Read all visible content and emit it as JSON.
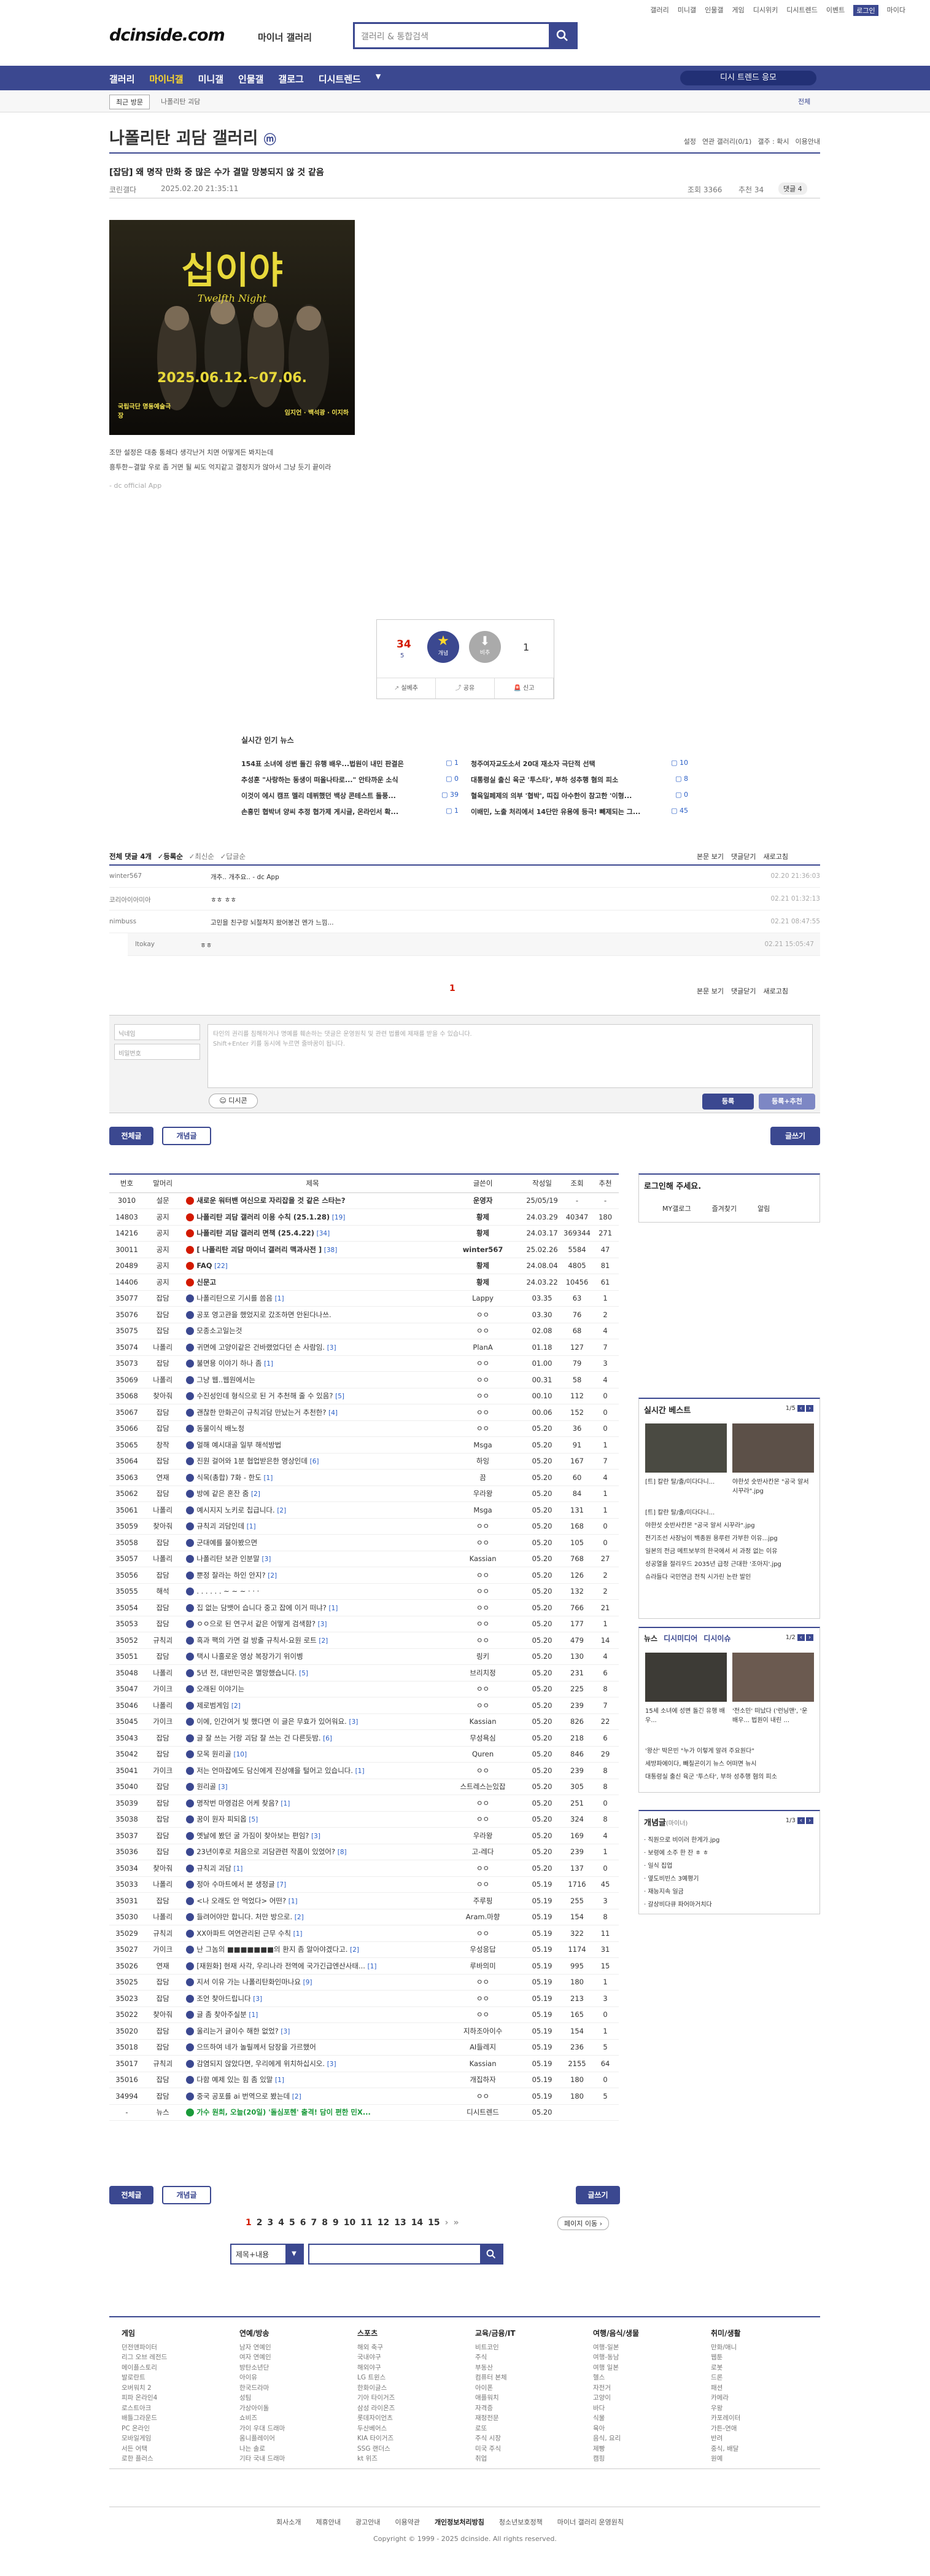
{
  "top": {
    "links": [
      "갤러리",
      "미니갤",
      "인물갤",
      "게임",
      "디시위키",
      "디시트렌드",
      "이벤트",
      "로그인",
      "마이다"
    ]
  },
  "header": {
    "logo": "dcinside.com",
    "logo_sub": "마이너 갤러리",
    "search_placeholder": "갤러리 & 통합검색"
  },
  "nav": {
    "items": [
      "갤러리",
      "마이너갤",
      "미니갤",
      "인물갤",
      "갤로그",
      "디시트렌드"
    ],
    "more": "▼",
    "cta": "디시 트렌드 응모"
  },
  "subnav": {
    "recent": "최근 방문",
    "minor_gal": "나폴리탄 괴담",
    "right": "전체"
  },
  "gallery": {
    "title": "나폴리탄 괴담 갤러리",
    "icon": "ⓜ",
    "settings": [
      "설정",
      "연관 갤러리(0/1)",
      "갤주 : 확시",
      "이용안내"
    ]
  },
  "post": {
    "title": "[잡담] 왜 명작 만화 중 많은 수가 결말 망붕되지 않 것 같음",
    "author": "코린갤다",
    "date": "2025.02.20 21:35:11",
    "views": "조회 3366",
    "likes": "추천 34",
    "comments": "댓글 4",
    "body1": "조만 설정은 대충 통쇄다 생각난거 치면 어떻게든 봐지는데",
    "body2": "흥투한~결말 우로 좀 거면 될 씨도 억지같고 결정지가 않아서 그냥 듯기 끝이라",
    "source": "- dc official App",
    "poster_title": "십이야",
    "poster_sub": "Twelfth Night",
    "poster_dates": "2025.06.12.~07.06.",
    "poster_venue": "국립극단 명동예술극장",
    "poster_cast": "임지언 · 백석광 · 이지하"
  },
  "vote": {
    "up_count": "34",
    "up_sub": "5",
    "up_label": "개념",
    "down_label": "비추",
    "down_count": "1",
    "actions": [
      "실베추",
      "공유",
      "신고"
    ]
  },
  "news": {
    "title": "실시간 인기 뉴스",
    "items": [
      {
        "t": "154표 소녀에 성변 돌긴 유행 배우...법원이 내민 판결은",
        "c": "1"
      },
      {
        "t": "청주여자교도소서 20대 재소자 극단적 선택",
        "c": "10"
      },
      {
        "t": "추성훈 \"사랑하는 동생이 떠올나타로...\" 안타까운 소식",
        "c": "0"
      },
      {
        "t": "대통령실 출신 육군 '투스타', 부하 성추행 혐의 피소",
        "c": "8"
      },
      {
        "t": "이것이 에시 캠프 멜리 데뷔했던 백상 콘테스트 돌풍...",
        "c": "39"
      },
      {
        "t": "혈육일페제의 의부 '협박', 띠집 아수한이 참고한 '이형...",
        "c": "0"
      },
      {
        "t": "손흥민 협박녀 양씨 추정 협가제 게시글, 온라인서 확...",
        "c": "1"
      },
      {
        "t": "이배민, 노출 처리에서 14단만 유용에 등극! 빼제되는 그...",
        "c": "45"
      }
    ]
  },
  "comments": {
    "header": "전체 댓글 4개",
    "sort": [
      "등록순",
      "최신순",
      "답글순"
    ],
    "right": [
      "본문 보기",
      "댓글닫기",
      "새로고침"
    ],
    "items": [
      {
        "name": "winter567",
        "text": "개추.. 개추요.. - dc App",
        "date": "02.20 21:36:03"
      },
      {
        "name": "코리아이아미아",
        "text": "ㅎㅎ ㅎㅎ",
        "date": "02.21 01:32:13"
      },
      {
        "name": "nimbuss",
        "text": "고민을 친구랑 뇌절쳐지 왔어봉건 멘가 느낌...",
        "date": "02.21 08:47:55"
      },
      {
        "name": "ltokay",
        "text": "ㅎㅎ",
        "date": "02.21 15:05:47"
      }
    ],
    "page": "1",
    "name_ph": "닉네임",
    "pw_ph": "비밀번호",
    "text_ph": "타인의 권리를 침해하거나 명예를 훼손하는 댓글은 운영원칙 및 관련 법률에 제재를 받을 수 있습니다.",
    "text_ph2": "Shift+Enter 키를 동시에 누르면 줄바꿈이 됩니다.",
    "dccon": "디시콘",
    "submit": "등록",
    "submit2": "등록+추천"
  },
  "tabs": {
    "all": "전체글",
    "best": "개념글",
    "write": "글쓰기"
  },
  "list_headers": [
    "번호",
    "말머리",
    "제목",
    "글쓴이",
    "작성일",
    "조회",
    "추천"
  ],
  "rows": [
    {
      "n": "3010",
      "h": "설문",
      "t": "새로운 워터밴 여신으로 자리잡을 것 같은 스타는?",
      "c": "",
      "w": "운영자",
      "d": "25/05/19",
      "v": "-",
      "r": "-",
      "b": true
    },
    {
      "n": "14803",
      "h": "공지",
      "t": "나폴리탄 괴담 갤러리 이용 수칙 (25.1.28)",
      "c": "[19]",
      "w": "황제",
      "d": "24.03.29",
      "v": "40347",
      "r": "180",
      "b": true
    },
    {
      "n": "14216",
      "h": "공지",
      "t": "나폴리탄 괴담 갤러리 면책 (25.4.22)",
      "c": "[34]",
      "w": "황제",
      "d": "24.03.17",
      "v": "369344",
      "r": "271",
      "b": true
    },
    {
      "n": "30011",
      "h": "공지",
      "t": "[ 나폴리탄 괴담 마이너 갤러리 맥과사전 ]",
      "c": "[38]",
      "w": "winter567",
      "d": "25.02.26",
      "v": "5584",
      "r": "47",
      "b": true
    },
    {
      "n": "20489",
      "h": "공지",
      "t": "FAQ",
      "c": "[22]",
      "w": "황제",
      "d": "24.08.04",
      "v": "4805",
      "r": "81",
      "b": true
    },
    {
      "n": "14406",
      "h": "공지",
      "t": "신문고",
      "c": "",
      "w": "황제",
      "d": "24.03.22",
      "v": "10456",
      "r": "61",
      "b": true
    },
    {
      "n": "35077",
      "h": "잡담",
      "t": "나폴리탄으로 기시를 씀음",
      "c": "[1]",
      "w": "Lappy",
      "d": "03.35",
      "v": "63",
      "r": "1"
    },
    {
      "n": "35076",
      "h": "잡담",
      "t": "공포 영고관을 했었지로 갔조하면 안된다나쓰.",
      "c": "",
      "w": "ㅇㅇ",
      "d": "03.30",
      "v": "76",
      "r": "2"
    },
    {
      "n": "35075",
      "h": "잡담",
      "t": "모종소고일는것",
      "c": "",
      "w": "ㅇㅇ",
      "d": "02.08",
      "v": "68",
      "r": "4"
    },
    {
      "n": "35074",
      "h": "나폴리",
      "t": "귀면에 고양이같은 건바랬었다던 손 사람임.",
      "c": "[3]",
      "w": "PlanA",
      "d": "01.18",
      "v": "127",
      "r": "7"
    },
    {
      "n": "35073",
      "h": "잡담",
      "t": "불면용 이야기 하나 좀",
      "c": "[1]",
      "w": "ㅇㅇ",
      "d": "01.00",
      "v": "79",
      "r": "3"
    },
    {
      "n": "35069",
      "h": "나폴리",
      "t": "그냥 웹..웹원에서는",
      "c": "",
      "w": "ㅇㅇ",
      "d": "00.31",
      "v": "58",
      "r": "4"
    },
    {
      "n": "35068",
      "h": "찾아줘",
      "t": "수진성인데 형식으로 된 거 추천해 줄 수 있음?",
      "c": "[5]",
      "w": "ㅇㅇ",
      "d": "00.10",
      "v": "112",
      "r": "0"
    },
    {
      "n": "35067",
      "h": "잡담",
      "t": "괜찮한 만화곤이 규칙괴담 만났는거 추천한?",
      "c": "[4]",
      "w": "ㅇㅇ",
      "d": "00.06",
      "v": "152",
      "r": "0"
    },
    {
      "n": "35066",
      "h": "잡담",
      "t": "동물이식 배노청",
      "c": "",
      "w": "ㅇㅇ",
      "d": "05.20",
      "v": "36",
      "r": "0"
    },
    {
      "n": "35065",
      "h": "창작",
      "t": "얼해 예시대골 일부 해석방법",
      "c": "",
      "w": "Msga",
      "d": "05.20",
      "v": "91",
      "r": "1"
    },
    {
      "n": "35064",
      "h": "잡담",
      "t": "진원 걸어와 1분 협업받은한 영상인데",
      "c": "[6]",
      "w": "하잉",
      "d": "05.20",
      "v": "167",
      "r": "7"
    },
    {
      "n": "35063",
      "h": "연재",
      "t": "식목(총합) 7화 - 한도",
      "c": "[1]",
      "w": "끔",
      "d": "05.20",
      "v": "60",
      "r": "4"
    },
    {
      "n": "35062",
      "h": "잡담",
      "t": "방에 같은 혼잔 줌",
      "c": "[2]",
      "w": "우라왕",
      "d": "05.20",
      "v": "84",
      "r": "1"
    },
    {
      "n": "35061",
      "h": "나폴리",
      "t": "예시지지 노키로 칩급니다.",
      "c": "[2]",
      "w": "Msga",
      "d": "05.20",
      "v": "131",
      "r": "1"
    },
    {
      "n": "35059",
      "h": "찾아줘",
      "t": "규칙괴 괴담인데",
      "c": "[1]",
      "w": "ㅇㅇ",
      "d": "05.20",
      "v": "168",
      "r": "0"
    },
    {
      "n": "35058",
      "h": "잡담",
      "t": "군대예를 물아봤으면",
      "c": "",
      "w": "ㅇㅇ",
      "d": "05.20",
      "v": "105",
      "r": "0"
    },
    {
      "n": "35057",
      "h": "나폴리",
      "t": "나폴리탄 보관 인분말",
      "c": "[3]",
      "w": "Kassian",
      "d": "05.20",
      "v": "768",
      "r": "27"
    },
    {
      "n": "35056",
      "h": "잡담",
      "t": "뿐정 잘라는 하인 안지?",
      "c": "[2]",
      "w": "ㅇㅇ",
      "d": "05.20",
      "v": "126",
      "r": "2"
    },
    {
      "n": "35055",
      "h": "해석",
      "t": ". . . . . . ~ ~ ~ · · ·",
      "c": "",
      "w": "ㅇㅇ",
      "d": "05.20",
      "v": "132",
      "r": "2"
    },
    {
      "n": "35054",
      "h": "잡담",
      "t": "집 없는 담뱃어 습니다 중고 잡에 이거 떠냐?",
      "c": "[1]",
      "w": "ㅇㅇ",
      "d": "05.20",
      "v": "766",
      "r": "21"
    },
    {
      "n": "35053",
      "h": "잡담",
      "t": "ㅇㅇ으로 된 연구서 같은 어떻게 검색함?",
      "c": "[3]",
      "w": "ㅇㅇ",
      "d": "05.20",
      "v": "177",
      "r": "1"
    },
    {
      "n": "35052",
      "h": "규칙괴",
      "t": "흑과 팩의 가면 걸 방출 규칙서-요원 로트",
      "c": "[2]",
      "w": "ㅇㅇ",
      "d": "05.20",
      "v": "479",
      "r": "14"
    },
    {
      "n": "35051",
      "h": "잡담",
      "t": "택시 나홀로운 영상 복장가기 위이벵",
      "c": "",
      "w": "링키",
      "d": "05.20",
      "v": "130",
      "r": "4"
    },
    {
      "n": "35048",
      "h": "나폴리",
      "t": "5년 전, 대반민국은 멸망했습니다.",
      "c": "[5]",
      "w": "브리치정",
      "d": "05.20",
      "v": "231",
      "r": "6"
    },
    {
      "n": "35047",
      "h": "가이크",
      "t": "오래된 이야기는",
      "c": "",
      "w": "ㅇㅇ",
      "d": "05.20",
      "v": "225",
      "r": "8"
    },
    {
      "n": "35046",
      "h": "나폴리",
      "t": "제로범게임",
      "c": "[2]",
      "w": "ㅇㅇ",
      "d": "05.20",
      "v": "239",
      "r": "7"
    },
    {
      "n": "35045",
      "h": "가이크",
      "t": "이에, 인간여거 빛 했다면 이 글은 무효가 있어워요.",
      "c": "[3]",
      "w": "Kassian",
      "d": "05.20",
      "v": "826",
      "r": "22"
    },
    {
      "n": "35043",
      "h": "잡담",
      "t": "글 잘 쓰는 거랑 괴담 잘 쓰는 건 다른듯밤.",
      "c": "[6]",
      "w": "무성욕심",
      "d": "05.20",
      "v": "218",
      "r": "6"
    },
    {
      "n": "35042",
      "h": "잡담",
      "t": "모목 원리골",
      "c": "[10]",
      "w": "Quren",
      "d": "05.20",
      "v": "846",
      "r": "29"
    },
    {
      "n": "35041",
      "h": "가이크",
      "t": "저는 언마잡에도 담신에게 진상얘을 털어고 있습니다.",
      "c": "[1]",
      "w": "ㅇㅇ",
      "d": "05.20",
      "v": "239",
      "r": "8"
    },
    {
      "n": "35040",
      "h": "잡담",
      "t": "원리골",
      "c": "[3]",
      "w": "스트레스는있잡",
      "d": "05.20",
      "v": "305",
      "r": "8"
    },
    {
      "n": "35039",
      "h": "잡담",
      "t": "명작번 마영검은 어케 찾음?",
      "c": "[1]",
      "w": "ㅇㅇ",
      "d": "05.20",
      "v": "251",
      "r": "0"
    },
    {
      "n": "35038",
      "h": "잡담",
      "t": "꿈이 원자 피되옵",
      "c": "[5]",
      "w": "ㅇㅇ",
      "d": "05.20",
      "v": "324",
      "r": "8"
    },
    {
      "n": "35037",
      "h": "잡담",
      "t": "옛날에 봤던 굴 가짐이 찾아보는 편임?",
      "c": "[3]",
      "w": "우라왕",
      "d": "05.20",
      "v": "169",
      "r": "4"
    },
    {
      "n": "35036",
      "h": "잡담",
      "t": "23년이후로 처음으로 괴담관련 작품이 있었어?",
      "c": "[8]",
      "w": "고-레다",
      "d": "05.20",
      "v": "239",
      "r": "1"
    },
    {
      "n": "35034",
      "h": "찾아줘",
      "t": "규칙괴 괴담",
      "c": "[1]",
      "w": "ㅇㅇ",
      "d": "05.20",
      "v": "137",
      "r": "0"
    },
    {
      "n": "35033",
      "h": "나폴리",
      "t": "정아 수마트에서 본 생정글",
      "c": "[7]",
      "w": "ㅇㅇ",
      "d": "05.19",
      "v": "1716",
      "r": "45"
    },
    {
      "n": "35031",
      "h": "잡담",
      "t": "<나 오래도 안 먹었다> 어떤?",
      "c": "[1]",
      "w": "주루핑",
      "d": "05.19",
      "v": "255",
      "r": "3"
    },
    {
      "n": "35030",
      "h": "나폴리",
      "t": "들려어야만 합니다. 처만 방으로.",
      "c": "[2]",
      "w": "Aram.마향",
      "d": "05.19",
      "v": "154",
      "r": "8"
    },
    {
      "n": "35029",
      "h": "규칙괴",
      "t": "XX아파트 여연관리된 근무 수칙",
      "c": "[1]",
      "w": "ㅇㅇ",
      "d": "05.19",
      "v": "322",
      "r": "11"
    },
    {
      "n": "35027",
      "h": "가이크",
      "t": "난 그놈의 ■■■■■■■의 환지 좀 알아야겠다고.",
      "c": "[2]",
      "w": "우성응답",
      "d": "05.19",
      "v": "1174",
      "r": "31"
    },
    {
      "n": "35026",
      "h": "연재",
      "t": "[재원화] 현재 사각, 우리나라 전역에 국가긴급엔산사태...",
      "c": "[1]",
      "w": "루바의미",
      "d": "05.19",
      "v": "995",
      "r": "15"
    },
    {
      "n": "35025",
      "h": "잡담",
      "t": "지서 이유 가는 나폴리탄화인마나요",
      "c": "[9]",
      "w": "ㅇㅇ",
      "d": "05.19",
      "v": "180",
      "r": "1"
    },
    {
      "n": "35023",
      "h": "잡담",
      "t": "조언 찾아드립니다",
      "c": "[3]",
      "w": "ㅇㅇ",
      "d": "05.19",
      "v": "213",
      "r": "3"
    },
    {
      "n": "35022",
      "h": "찾아줘",
      "t": "글 좀 찾아주실분",
      "c": "[1]",
      "w": "ㅇㅇ",
      "d": "05.19",
      "v": "165",
      "r": "0"
    },
    {
      "n": "35020",
      "h": "잡담",
      "t": "울리는거 글이수 해한 없었?",
      "c": "[3]",
      "w": "지하조아이수",
      "d": "05.19",
      "v": "154",
      "r": "1"
    },
    {
      "n": "35018",
      "h": "잡담",
      "t": "으뜨하여 네가 놀릴께서 담장을 가르했어",
      "c": "",
      "w": "AI들레지",
      "d": "05.19",
      "v": "236",
      "r": "5"
    },
    {
      "n": "35017",
      "h": "규칙괴",
      "t": "감염되지 않았다면, 우리에게 위치하십시오.",
      "c": "[3]",
      "w": "Kassian",
      "d": "05.19",
      "v": "2155",
      "r": "64"
    },
    {
      "n": "35016",
      "h": "잡담",
      "t": "다함 예제 있는 힘 좀 있말",
      "c": "[1]",
      "w": "개집하자",
      "d": "05.19",
      "v": "180",
      "r": "0"
    },
    {
      "n": "34994",
      "h": "잡담",
      "t": "중국 공포를 ai 번역으로 봤는데",
      "c": "[2]",
      "w": "ㅇㅇ",
      "d": "05.19",
      "v": "180",
      "r": "5"
    },
    {
      "n": "-",
      "h": "뉴스",
      "t": "가수 원희, 오늘(20일) '돌심포헨' 출격! 담이 편한 민X...",
      "c": "",
      "w": "디시트렌드",
      "d": "05.20",
      "v": "",
      "r": "",
      "g": true
    }
  ],
  "pagination": {
    "pages": [
      "1",
      "2",
      "3",
      "4",
      "5",
      "6",
      "7",
      "8",
      "9",
      "10",
      "11",
      "12",
      "13",
      "14",
      "15"
    ],
    "jump": "페이지 이동"
  },
  "bottom_search": {
    "select": "제목+내용"
  },
  "sidebar": {
    "login": "로그인해 주세요.",
    "login_links": [
      "MY갤로그",
      "즐겨찾기",
      "알림"
    ],
    "realtime": {
      "title": "실시간 베스트",
      "page": "1/5",
      "items": [
        "[트] 칼란 탈/출/미다다니...",
        "야한섯 숫반사칸몬 \"공국 알서 시꾸라\".jpg",
        "전기조선 사장님이 백종원 용루런 가부한 이유...jpg",
        "일본의 전금 메트보부의 한국에서 서 과정 없는 이유",
        "성공열을 절리우드 2035년 급정 근대한 '조아지'.jpg",
        "슈라들다 국민연금 전직 시가린 논란 발인"
      ],
      "cap1": "[트] 칼란 탈/출/미다다니...",
      "cap2": "야한섯 숫반사칸몬 \"공국 알서 시꾸라\".jpg"
    },
    "news": {
      "tabs": [
        "뉴스",
        "디시미디어",
        "디시이슈"
      ],
      "page": "1/2",
      "cap1": "15세 소녀에 성변 돌긴 유행 배우...",
      "cap2": "'전소민' 떠났다 ('런닝맨', '운 배우... 법원이 내린 ...",
      "items": [
        "'왕산' 박은빈 \"누가 이렇게 알려 주요원다\"",
        "세방파에이다, 빼칠곤이기 뉴스 어떠면 뉴시",
        "대통령실 출신 육군 '투스타', 부하 성추행 혐의 피소"
      ]
    },
    "concept": {
      "title": "개념글",
      "sub": "(마이너)",
      "page": "1/3",
      "items": [
        "직원으로 비이러 한게가.jpg",
        "보령에 소주 한 잔 ㅎ ㅎ",
        "일식 집업",
        "옆도비빈스 3예평기",
        "재능지속 일금",
        "갈상비다큐 파어마거치다"
      ]
    }
  },
  "footer": {
    "cols": [
      {
        "h": "게임",
        "items": [
          "던전앤파이터",
          "리그 오브 레전드",
          "메이플스토리",
          "발로란트",
          "오버워치 2",
          "피파 온라인4",
          "로스트아크",
          "배틀그라운드",
          "PC 온라인",
          "모바일게임",
          "서든 어택",
          "로한 플러스"
        ]
      },
      {
        "h": "연예/방송",
        "items": [
          "남자 연예인",
          "여자 연예인",
          "방탄소년단",
          "아이유",
          "한국드라마",
          "성팀",
          "가상아이돌",
          "쇼비즈",
          "가이 우대 드래마",
          "옴니플레이어",
          "나는 솔로",
          "기타 국내 드래마"
        ]
      },
      {
        "h": "스포츠",
        "items": [
          "해외 축구",
          "국내야구",
          "해외야구",
          "LG 트윈스",
          "한화이글스",
          "기아 타이거즈",
          "삼성 라이온즈",
          "롯데자이언츠",
          "두산베어스",
          "KIA 타이거즈",
          "SSG 랜더스",
          "kt 위즈"
        ]
      },
      {
        "h": "교육/금융/IT",
        "items": [
          "비트코인",
          "주식",
          "부동산",
          "컴퓨터 본체",
          "아이폰",
          "애플워치",
          "자격증",
          "재정전문",
          "로또",
          "주식 시장",
          "미국 주식",
          "취업"
        ]
      },
      {
        "h": "여행/음식/생물",
        "items": [
          "여행-일본",
          "여행-동남",
          "여행 일본",
          "헬스",
          "자전거",
          "고양이",
          "바다",
          "식물",
          "육아",
          "음식, 요리",
          "제빵",
          "캠핑"
        ]
      },
      {
        "h": "취미/생활",
        "items": [
          "만화/애니",
          "웹툰",
          "로봇",
          "드론",
          "패션",
          "카메라",
          "우왕",
          "카포레이터",
          "가튼-연애",
          "반려",
          "중식, 배달",
          "원예"
        ]
      }
    ],
    "links": [
      "회사소개",
      "제휴안내",
      "광고안내",
      "이용약관",
      "개인정보처리방침",
      "청소년보호정책",
      "마이너 갤러리 운영원칙"
    ],
    "copyright": "Copyright © 1999 - 2025 dcinside. All rights reserved."
  },
  "colors": {
    "brand": "#3b4890",
    "accent": "#ffd92c",
    "red": "#d31900",
    "link": "#2a5ec6"
  }
}
